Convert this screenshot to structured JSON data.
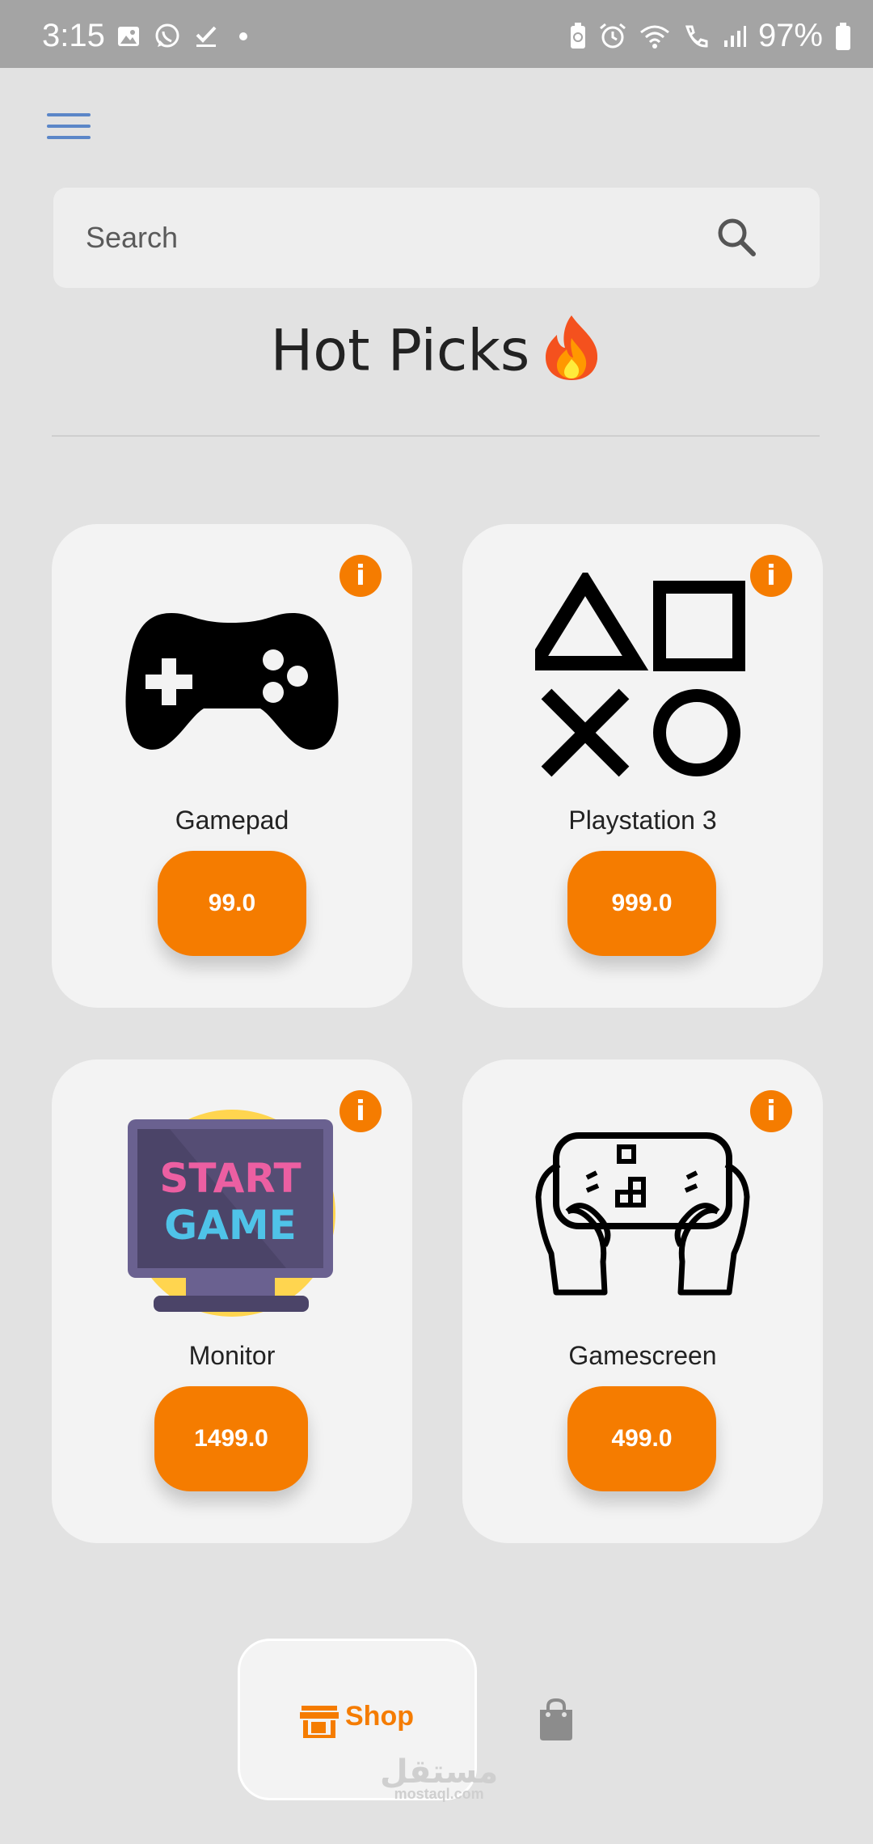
{
  "status_bar": {
    "time": "3:15",
    "battery": "97%",
    "icons_left": [
      "gallery-icon",
      "whatsapp-icon",
      "download-done-icon",
      "dot-icon"
    ],
    "icons_right": [
      "battery-saver-icon",
      "alarm-icon",
      "wifi-icon",
      "wifi-call-icon",
      "signal-icon",
      "battery-icon"
    ]
  },
  "header": {
    "menu_icon": "hamburger-menu-icon"
  },
  "search": {
    "placeholder": "Search",
    "icon": "search-icon"
  },
  "page": {
    "title": "Hot Picks",
    "title_icon": "fire-icon"
  },
  "products": [
    {
      "name": "Gamepad",
      "price": "99.0",
      "icon": "gamepad-icon"
    },
    {
      "name": "Playstation 3",
      "price": "999.0",
      "icon": "playstation-symbols-icon"
    },
    {
      "name": "Monitor",
      "price": "1499.0",
      "icon": "start-game-monitor-icon",
      "image_text": [
        "START",
        "GAME"
      ]
    },
    {
      "name": "Gamescreen",
      "price": "499.0",
      "icon": "handheld-console-icon"
    }
  ],
  "bottom_nav": {
    "shop_label": "Shop",
    "shop_icon": "store-icon",
    "bag_icon": "shopping-bag-icon"
  },
  "watermark": {
    "arabic": "مستقل",
    "latin": "mostaql.com"
  },
  "colors": {
    "accent": "#f57c00",
    "background": "#e2e2e2",
    "card": "#f3f3f3",
    "menu": "#5b86c8"
  }
}
